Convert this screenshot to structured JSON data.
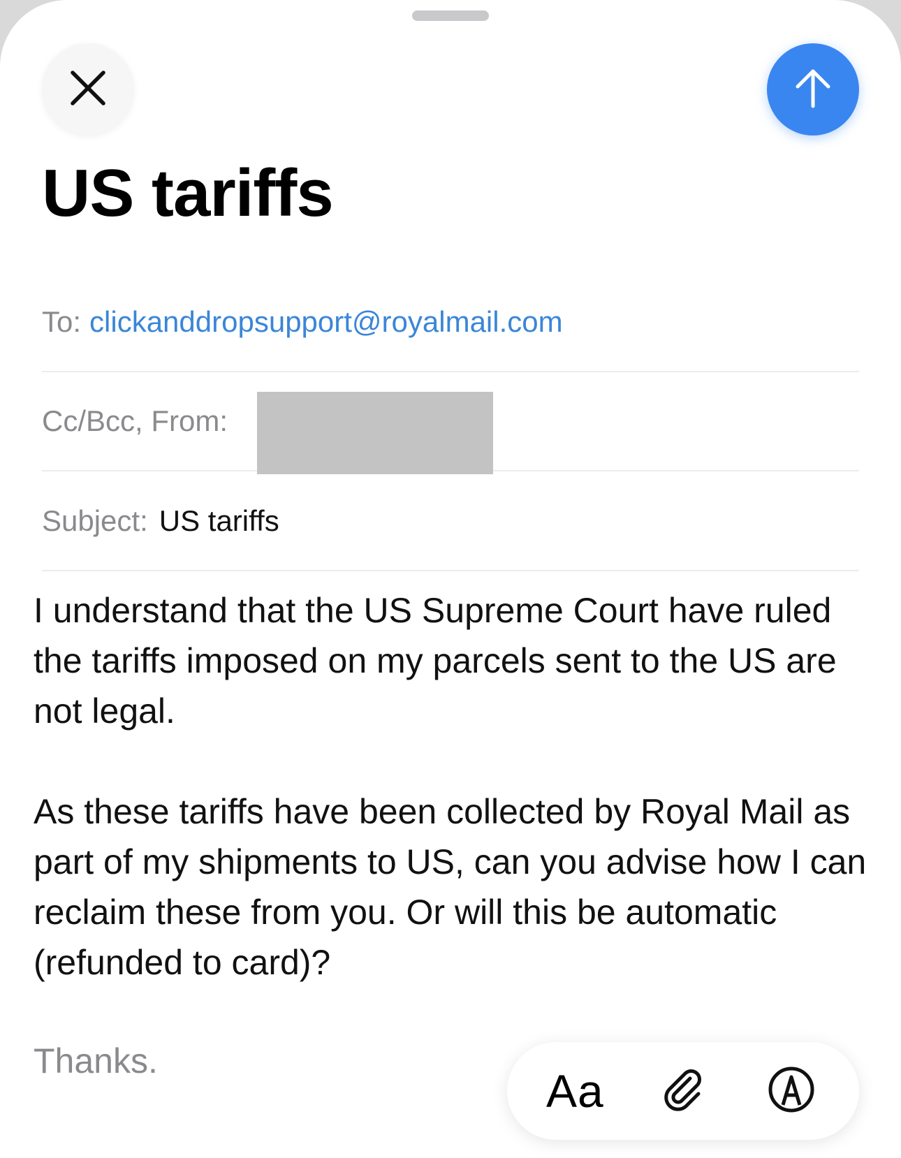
{
  "compose": {
    "title": "US tariffs",
    "icons": {
      "close": "close-icon",
      "send": "arrow-up-icon",
      "attach": "paperclip-icon",
      "markup": "markup-pen-icon"
    },
    "colors": {
      "accent": "#3a86f0",
      "link": "#3a86d8",
      "label": "#8a8a8e"
    }
  },
  "fields": {
    "to_label": "To:",
    "to_value": "clickanddropsupport@royalmail.com",
    "ccbcc_label": "Cc/Bcc, From:",
    "subject_label": "Subject:",
    "subject_value": "US tariffs"
  },
  "body": {
    "paragraph1": "I understand that the US Supreme Court have ruled the tariffs imposed on my parcels sent to the US are not legal.",
    "paragraph2": "As these tariffs have been collected by Royal Mail as part of my shipments to US, can you advise how I can reclaim these from you. Or will this be automatic (refunded to card)?",
    "signoff": "Thanks."
  },
  "toolbar": {
    "format_label": "Aa"
  }
}
